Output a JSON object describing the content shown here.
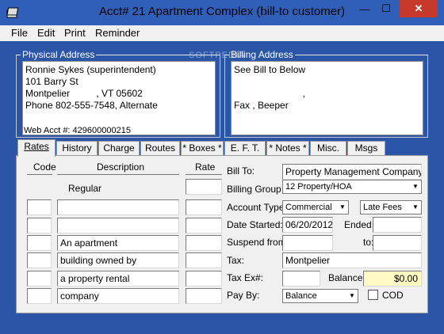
{
  "window": {
    "title": "Acct# 21 Apartment Complex (bill-to customer)",
    "minimize_glyph": "—",
    "maximize_glyph": "☐",
    "close_glyph": "✕"
  },
  "menu": [
    "File",
    "Edit",
    "Print",
    "Reminder"
  ],
  "physical_address": {
    "title": "Physical Address",
    "lines": [
      "Ronnie Sykes (superintendent)",
      "101 Barry St",
      "Montpelier          , VT 05602",
      "Phone 802-555-7548, Alternate"
    ],
    "web_acct": "Web Acct #: 429600000215"
  },
  "billing_address": {
    "title": "Billing Address",
    "lines": [
      "See Bill to Below",
      "",
      "                          ,",
      "Fax , Beeper"
    ]
  },
  "tabs": [
    "Rates",
    "History",
    "Charge",
    "Routes",
    "* Boxes *",
    "E. F. T.",
    "* Notes *",
    "Misc.",
    "Msgs"
  ],
  "rates": {
    "col_code": "Code",
    "col_description": "Description",
    "col_rate": "Rate",
    "regular_label": "Regular",
    "descriptions": [
      "",
      "An apartment",
      "building owned by",
      "a property rental",
      "company"
    ]
  },
  "bill_to": {
    "label": "Bill To:",
    "value": "Property Management Company"
  },
  "billing_group": {
    "label": "Billing Group:",
    "value": "12 Property/HOA"
  },
  "account_type": {
    "label": "Account Type:",
    "value": "Commercial",
    "late_fees": "Late Fees"
  },
  "date_started": {
    "label": "Date Started:",
    "value": "06/20/2012"
  },
  "ended": {
    "label": "Ended:",
    "value": ""
  },
  "suspend_from": {
    "label": "Suspend from:",
    "value": ""
  },
  "suspend_to": {
    "label": "to:",
    "value": ""
  },
  "tax": {
    "label": "Tax:",
    "value": "Montpelier"
  },
  "tax_ex": {
    "label": "Tax Ex#:",
    "value": ""
  },
  "balance": {
    "label": "Balance:",
    "value": "$0.00"
  },
  "pay_by": {
    "label": "Pay By:",
    "value": "Balance"
  },
  "cod": {
    "label": "COD"
  },
  "watermark": "SOFTPEDIA"
}
